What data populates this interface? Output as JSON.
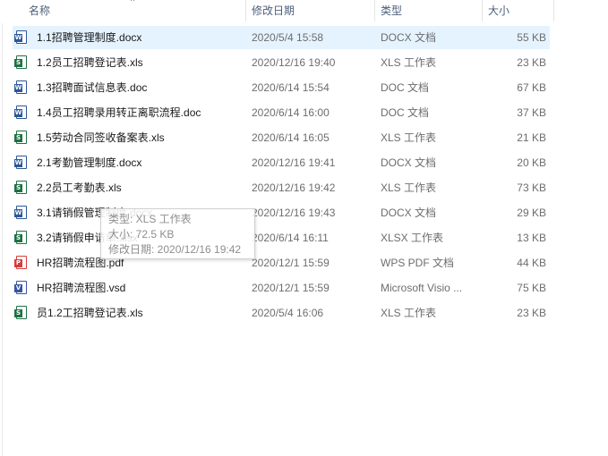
{
  "columns": {
    "name": "名称",
    "date": "修改日期",
    "type": "类型",
    "size": "大小"
  },
  "sort_indicator": "^",
  "files": [
    {
      "name": "1.1招聘管理制度.docx",
      "date": "2020/5/4 15:58",
      "type": "DOCX 文档",
      "size": "55 KB",
      "icon": "word-icon",
      "selected": true
    },
    {
      "name": "1.2员工招聘登记表.xls",
      "date": "2020/12/16 19:40",
      "type": "XLS 工作表",
      "size": "23 KB",
      "icon": "excel-icon"
    },
    {
      "name": "1.3招聘面试信息表.doc",
      "date": "2020/6/14 15:54",
      "type": "DOC 文档",
      "size": "67 KB",
      "icon": "word-icon"
    },
    {
      "name": "1.4员工招聘录用转正离职流程.doc",
      "date": "2020/6/14 16:00",
      "type": "DOC 文档",
      "size": "37 KB",
      "icon": "word-icon"
    },
    {
      "name": "1.5劳动合同签收备案表.xls",
      "date": "2020/6/14 16:05",
      "type": "XLS 工作表",
      "size": "21 KB",
      "icon": "excel-icon"
    },
    {
      "name": "2.1考勤管理制度.docx",
      "date": "2020/12/16 19:41",
      "type": "DOCX 文档",
      "size": "20 KB",
      "icon": "word-icon"
    },
    {
      "name": "2.2员工考勤表.xls",
      "date": "2020/12/16 19:42",
      "type": "XLS 工作表",
      "size": "73 KB",
      "icon": "excel-icon"
    },
    {
      "name": "3.1请销假管理制度.docx",
      "date": "2020/12/16 19:43",
      "type": "DOCX 文档",
      "size": "29 KB",
      "icon": "word-icon"
    },
    {
      "name": "3.2请销假申请单.xlsx",
      "date": "2020/6/14 16:11",
      "type": "XLSX 工作表",
      "size": "13 KB",
      "icon": "excel-icon"
    },
    {
      "name": "HR招聘流程图.pdf",
      "date": "2020/12/1 15:59",
      "type": "WPS PDF 文档",
      "size": "44 KB",
      "icon": "pdf-icon"
    },
    {
      "name": "HR招聘流程图.vsd",
      "date": "2020/12/1 15:59",
      "type": "Microsoft Visio ...",
      "size": "75 KB",
      "icon": "visio-icon"
    },
    {
      "name": "员1.2工招聘登记表.xls",
      "date": "2020/5/4 16:06",
      "type": "XLS 工作表",
      "size": "23 KB",
      "icon": "excel-icon"
    }
  ],
  "tooltip": {
    "type_line": "类型: XLS 工作表",
    "size_line": "大小: 72.5 KB",
    "date_line": "修改日期: 2020/12/16 19:42"
  },
  "icon_colors": {
    "word-icon": "#2b5797",
    "excel-icon": "#1e7145",
    "pdf-icon": "#d83b3b",
    "visio-icon": "#3955a3"
  },
  "icon_letters": {
    "word-icon": "W",
    "excel-icon": "S",
    "pdf-icon": "P",
    "visio-icon": "V"
  }
}
